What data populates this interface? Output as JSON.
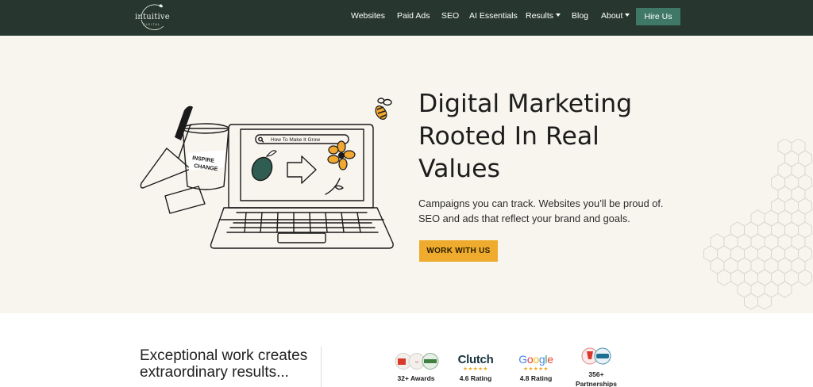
{
  "nav": {
    "logo": {
      "name": "intuitive",
      "sub": "DIGITAL"
    },
    "items": [
      {
        "label": "Websites"
      },
      {
        "label": "Paid Ads"
      },
      {
        "label": "SEO"
      },
      {
        "label": "AI Essentials"
      },
      {
        "label": "Results",
        "dropdown": true
      },
      {
        "label": "Blog"
      },
      {
        "label": "About",
        "dropdown": true
      }
    ],
    "cta": "Hire Us"
  },
  "hero": {
    "title_lines": [
      "Digital Marketing",
      "Rooted In Real",
      "Values"
    ],
    "subtitle_lines": [
      "Campaigns you can track. Websites you’ll be proud of.",
      "SEO and ads that reflect your brand and goals."
    ],
    "cta": "WORK WITH US",
    "illustration": {
      "search_text": "How To Make It Grow",
      "pot_text_1": "INSPIRE",
      "pot_text_2": "CHANGE"
    }
  },
  "results": {
    "tagline_lines": [
      "Exceptional work creates",
      "extraordinary results..."
    ],
    "stats": [
      {
        "label": "32+ Awards",
        "icon": "award-badges-icon"
      },
      {
        "label": "4.6 Rating",
        "brand": "Clutch",
        "icon": "clutch-logo",
        "stars": "★★★★★"
      },
      {
        "label": "4.8 Rating",
        "brand": "Google",
        "icon": "google-logo",
        "stars": "★★★★★"
      },
      {
        "label": "356+",
        "label2": "Partnerships",
        "icon": "partner-badges-icon"
      }
    ]
  },
  "colors": {
    "nav_bg": "#27372f",
    "hire_button": "#3f7867",
    "hero_bg": "#f8f5ef",
    "cta_bg": "#eeab2d",
    "star": "#f0a81d"
  }
}
